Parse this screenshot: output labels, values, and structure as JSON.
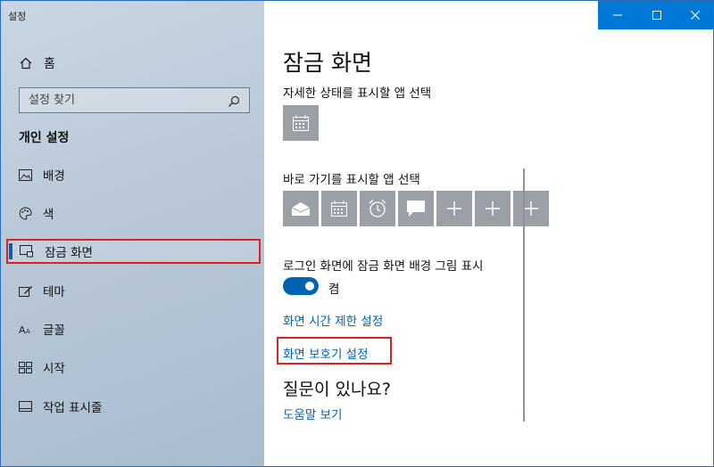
{
  "app": {
    "title": "설정"
  },
  "window_controls": {
    "minimize": "minimize",
    "maximize": "maximize",
    "close": "close"
  },
  "sidebar": {
    "home_label": "홈",
    "search_placeholder": "설정 찾기",
    "section_title": "개인 설정",
    "items": [
      {
        "label": "배경",
        "icon": "picture-icon"
      },
      {
        "label": "색",
        "icon": "palette-icon"
      },
      {
        "label": "잠금 화면",
        "icon": "lock-screen-icon",
        "selected": true
      },
      {
        "label": "테마",
        "icon": "theme-icon"
      },
      {
        "label": "글꼴",
        "icon": "font-icon"
      },
      {
        "label": "시작",
        "icon": "start-icon"
      },
      {
        "label": "작업 표시줄",
        "icon": "taskbar-icon"
      }
    ]
  },
  "main": {
    "title": "잠금 화면",
    "detailed_status_label": "자세한 상태를 표시할 앱 선택",
    "quick_status_label": "바로 가기를 표시할 앱 선택",
    "quick_apps": [
      "mail-icon",
      "calendar-icon",
      "alarm-icon",
      "message-icon",
      "plus-icon",
      "plus-icon",
      "plus-icon"
    ],
    "signin_background_label": "로그인 화면에 잠금 화면 배경 그림 표시",
    "toggle_state": "켬",
    "timeout_link": "화면 시간 제한 설정",
    "screensaver_link": "화면 보호기 설정",
    "help_title": "질문이 있나요?",
    "help_link": "도움말 보기"
  },
  "colors": {
    "accent": "#0063b1",
    "titlebar": "#0078d7",
    "highlight": "#e02020",
    "tile": "#9aa0a6"
  }
}
